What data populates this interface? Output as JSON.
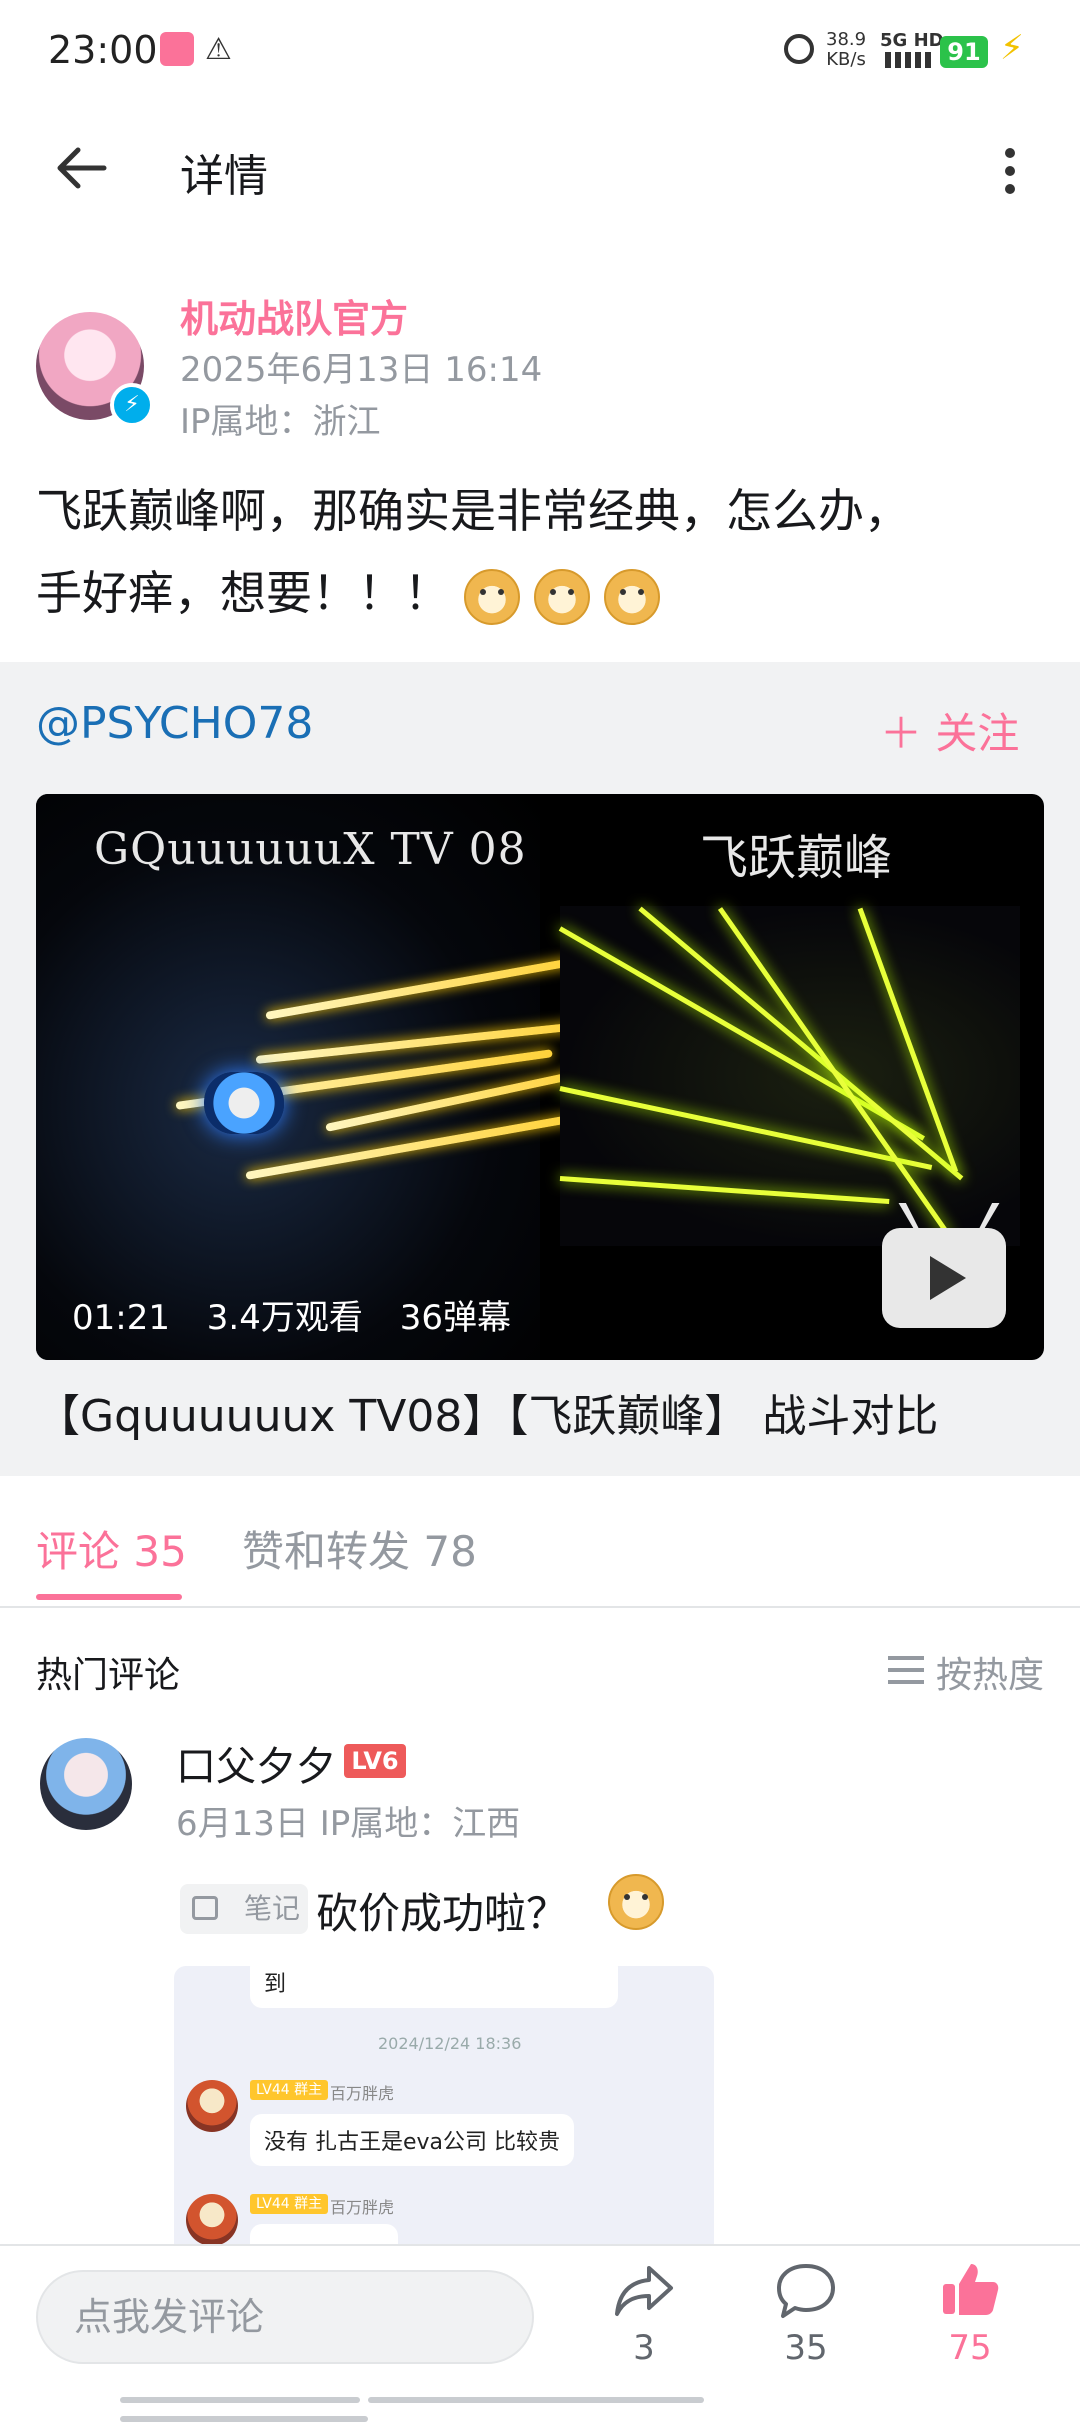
{
  "status_bar": {
    "time": "23:00",
    "net_speed_value": "38.9",
    "net_speed_unit": "KB/s",
    "network": "5G HD",
    "battery": "91"
  },
  "header": {
    "title": "详情"
  },
  "post": {
    "author": "机动战队官方",
    "time": "2025年6月13日 16:14",
    "ip": "IP属地：浙江",
    "content_line1": "飞跃巅峰啊，那确实是非常经典，怎么办，",
    "content_line2": "手好痒，想要！！！"
  },
  "forward": {
    "user": "@PSYCHO78",
    "follow_label": "＋ 关注",
    "video": {
      "left_title": "GQuuuuuuX TV 08",
      "right_title": "飞跃巅峰",
      "duration": "01:21",
      "views": "3.4万观看",
      "danmaku": "36弹幕"
    },
    "caption": "【Gquuuuuux TV08】【飞跃巅峰】 战斗对比"
  },
  "tabs": {
    "comments": "评论 35",
    "likes_reposts": "赞和转发 78"
  },
  "comments_section": {
    "hot_label": "热门评论",
    "sort_label": "按热度",
    "comment": {
      "user": "口父夕夕",
      "level": "LV6",
      "meta": "6月13日  IP属地：江西",
      "note_tag": "笔记",
      "text": "砍价成功啦？",
      "preview": {
        "top_bubble": "到",
        "timestamp": "2024/12/24 18:36",
        "msg_badge": "LV44 群主",
        "msg_name": "百万胖虎",
        "msg_text": "没有 扎古王是eva公司 比较贵",
        "msg2_badge": "LV44 群主",
        "msg2_name": "百万胖虎"
      }
    }
  },
  "bottom_bar": {
    "input_placeholder": "点我发评论",
    "share_count": "3",
    "comment_count": "35",
    "like_count": "75"
  },
  "colors": {
    "brand_pink": "#fb7299",
    "link_blue": "#1a6fb5",
    "muted": "#9499a0"
  },
  "icons": [
    "back-arrow-icon",
    "more-vertical-icon",
    "verified-icon",
    "doge-emoji",
    "tv-play-icon",
    "sort-icon",
    "note-icon",
    "share-icon",
    "comment-icon",
    "like-icon"
  ]
}
